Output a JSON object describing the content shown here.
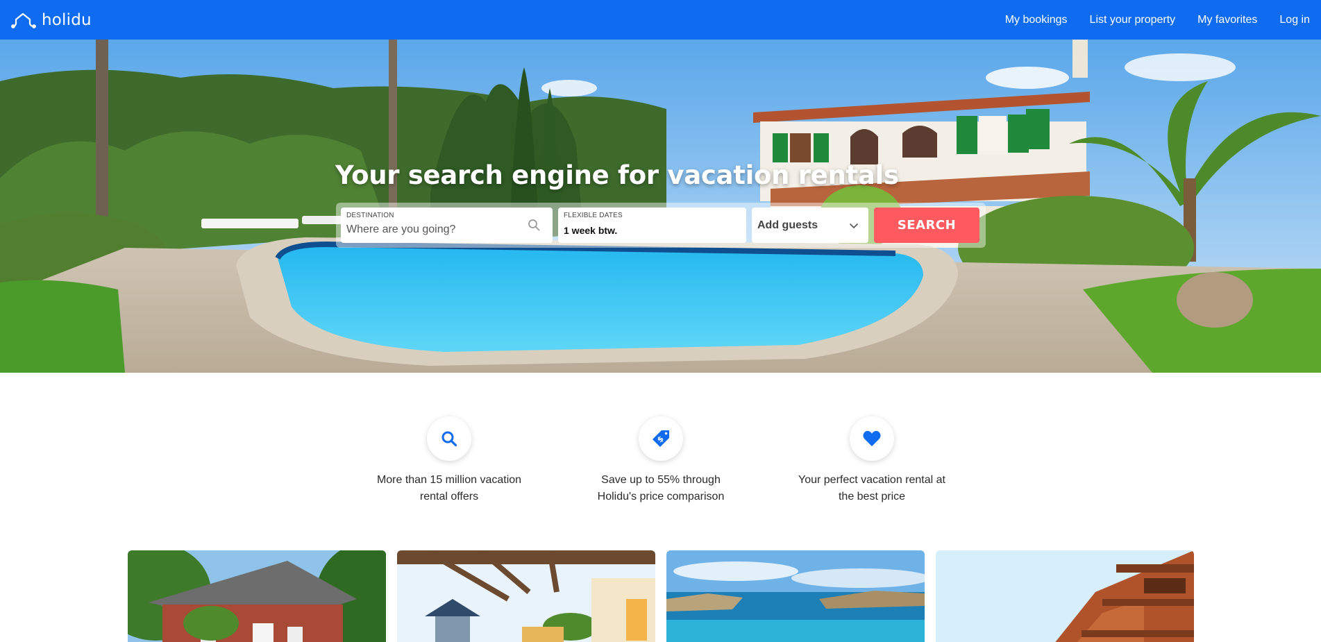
{
  "header": {
    "brand": "holidu",
    "nav": {
      "bookings": "My bookings",
      "list_property": "List your property",
      "favorites": "My favorites",
      "login": "Log in"
    }
  },
  "hero": {
    "title": "Your search engine for vacation rentals",
    "search": {
      "destination_label": "DESTINATION",
      "destination_placeholder": "Where are you going?",
      "dates_label": "FLEXIBLE DATES",
      "dates_value": "1 week btw.",
      "guests_label": "Add guests",
      "search_label": "SEARCH"
    }
  },
  "features": [
    {
      "icon": "search-icon",
      "text_line1": "More than 15 million vacation",
      "text_line2": "rental offers"
    },
    {
      "icon": "price-tag-icon",
      "text_line1": "Save up to 55% through",
      "text_line2": "Holidu's price comparison"
    },
    {
      "icon": "heart-icon",
      "text_line1": "Your perfect vacation rental at",
      "text_line2": "the best price"
    }
  ],
  "colors": {
    "brand_blue": "#0f6bef",
    "search_button": "#fe5a5f"
  }
}
